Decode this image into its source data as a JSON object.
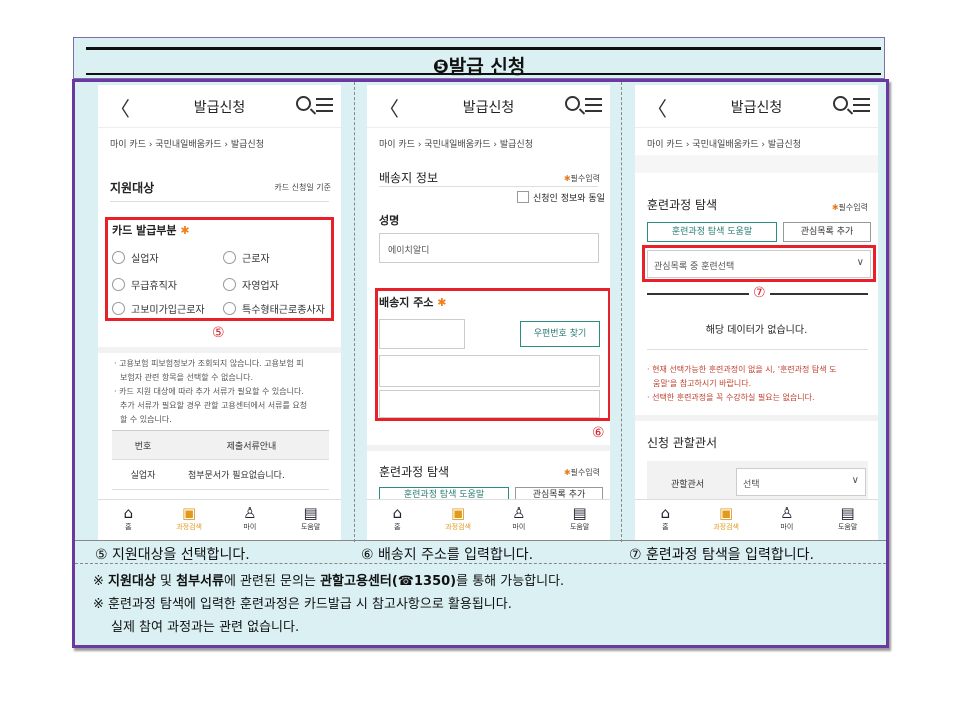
{
  "title": "❺발급 신청",
  "panels": {
    "p1": {
      "header": "발급신청",
      "breadcrumb": "마이 카드 › 국민내일배움카드 › 발급신청",
      "section": "지원대상",
      "section_right": "카드 신청일 기준",
      "card_section": "카드 발급부분",
      "options": [
        "실업자",
        "근로자",
        "무급휴직자",
        "자영업자",
        "고보미가입근로자",
        "특수형태근로종사자"
      ],
      "marker": "⑤",
      "note1": "· 고용보험 피보험정보가 조회되지 않습니다. 고용보험 피",
      "note2": "보험자 관련 항목을 선택할 수 없습니다.",
      "note3": "· 카드 지원 대상에 따라 추가 서류가 필요할 수 있습니다.",
      "note4": "추가 서류가 필요할 경우 관할 고용센터에서 서류를 요청",
      "note5": "할 수 있습니다.",
      "table_head": [
        "번호",
        "제출서류안내"
      ],
      "table_row": [
        "실업자",
        "첨부문서가 필요없습니다."
      ]
    },
    "p2": {
      "header": "발급신청",
      "breadcrumb": "마이 카드 › 국민내일배움카드 › 발급신청",
      "section": "배송지 정보",
      "required": "필수입력",
      "same_check": "신청인 정보와 동일",
      "name_label": "성명",
      "name_value": "에이치알디",
      "addr_label": "배송지 주소",
      "zip_button": "우편번호 찾기",
      "marker": "⑥",
      "course_section": "훈련과정 탐색",
      "course_required": "필수입력",
      "help_button": "훈련과정 탐색 도움말",
      "add_button": "관심목록 추가"
    },
    "p3": {
      "header": "발급신청",
      "breadcrumb": "마이 카드 › 국민내일배움카드 › 발급신청",
      "section": "훈련과정 탐색",
      "required": "필수입력",
      "help_button": "훈련과정 탐색 도움말",
      "add_button": "관심목록 추가",
      "select_value": "관심목록 중 훈련선택",
      "marker": "⑦",
      "empty": "해당 데이터가 없습니다.",
      "note1": "· 현재 선택가능한 훈련과정이 없을 시, '훈련과정 탐색 도",
      "note2": "움말'을 참고하시기 바랍니다.",
      "note3": "· 선택한 훈련과정을 꼭 수강하실 필요는 없습니다.",
      "office_section": "신청 관할관서",
      "office_label": "관할관서",
      "office_value": "선택"
    }
  },
  "bottom_nav": [
    "홈",
    "과정검색",
    "마이",
    "도움말"
  ],
  "captions": [
    "⑤ 지원대상을 선택합니다.",
    "⑥ 배송지 주소를 입력합니다.",
    "⑦ 훈련과정 탐색을 입력합니다."
  ],
  "notes": {
    "n1_pre": "※ ",
    "n1_b1": "지원대상",
    "n1_t1": " 및 ",
    "n1_b2": "첨부서류",
    "n1_t2": "에 관련된 문의는 ",
    "n1_b3": "관할고용센터(☎1350)",
    "n1_t3": "를 통해 가능합니다.",
    "n2": "※ 훈련과정 탐색에 입력한 훈련과정은 카드발급 시 참고사항으로 활용됩니다.",
    "n3": "실제 참여 과정과는 관련 없습니다."
  }
}
